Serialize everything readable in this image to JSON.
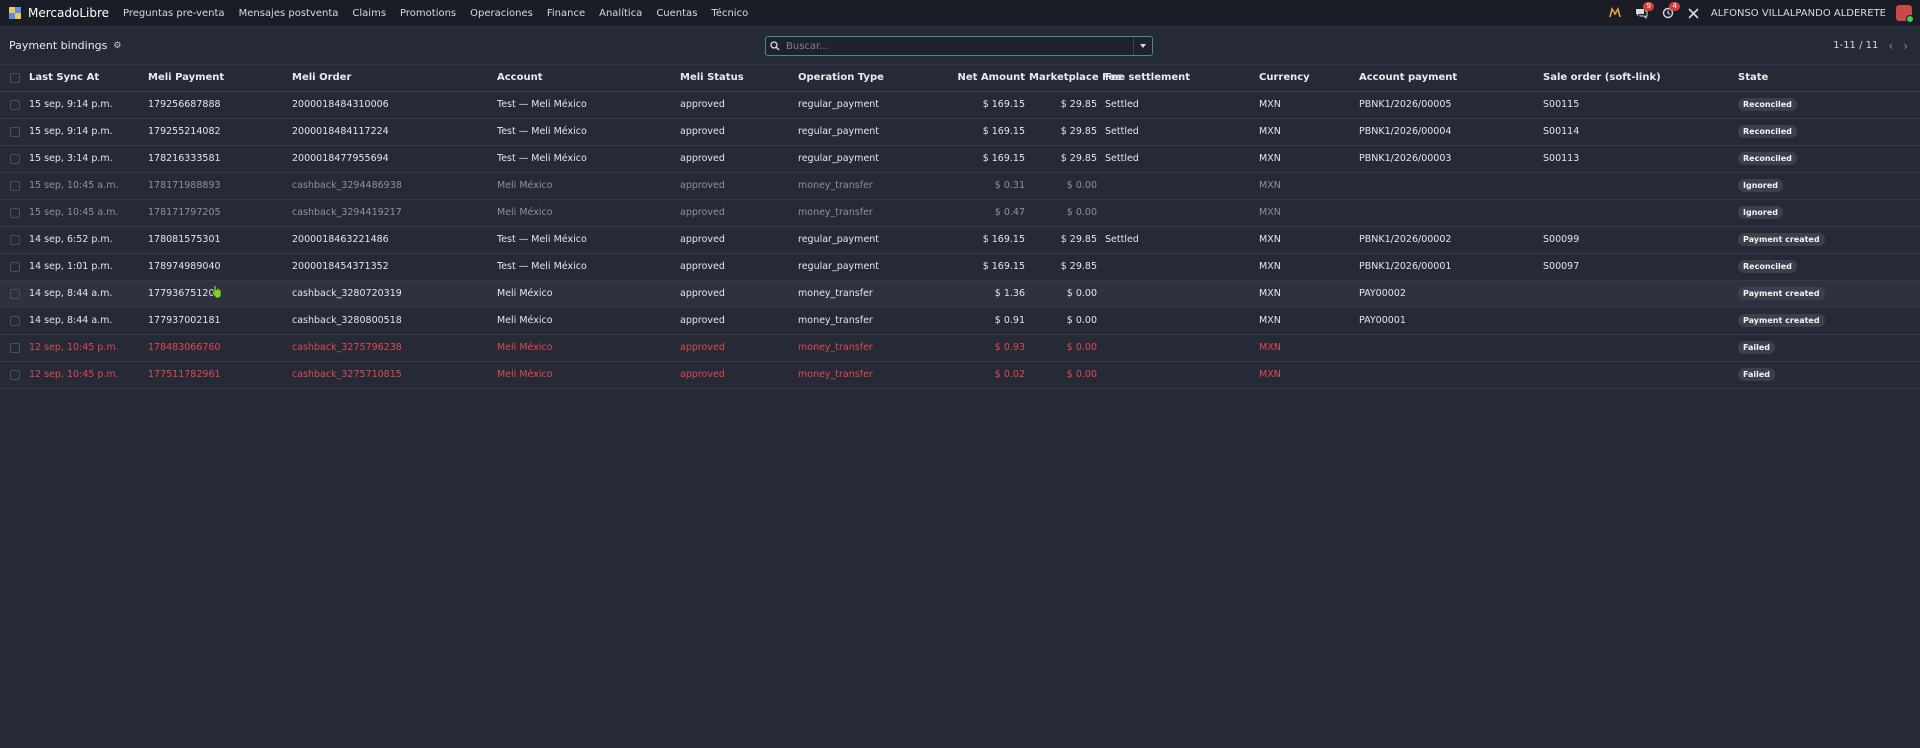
{
  "nav": {
    "brand": "MercadoLibre",
    "menu": [
      "Preguntas pre-venta",
      "Mensajes postventa",
      "Claims",
      "Promotions",
      "Operaciones",
      "Finance",
      "Analítica",
      "Cuentas",
      "Técnico"
    ],
    "messages_badge": "9",
    "activities_badge": "4",
    "user": "ALFONSO VILLALPANDO ALDERETE"
  },
  "control": {
    "title": "Payment bindings",
    "search_placeholder": "Buscar...",
    "pager": "1-11 / 11"
  },
  "table": {
    "headers": [
      "Last Sync At",
      "Meli Payment",
      "Meli Order",
      "Account",
      "Meli Status",
      "Operation Type",
      "Net Amount",
      "Marketplace Fee",
      "Fee settlement",
      "Currency",
      "Account payment",
      "Sale order (soft-link)",
      "State"
    ],
    "rows": [
      {
        "style": "normal",
        "cells": [
          "15 sep, 9:14 p.m.",
          "179256687888",
          "2000018484310006",
          "Test — Meli México",
          "approved",
          "regular_payment",
          "$ 169.15",
          "$ 29.85",
          "Settled",
          "MXN",
          "PBNK1/2026/00005",
          "S00115",
          "Reconciled"
        ]
      },
      {
        "style": "normal",
        "cells": [
          "15 sep, 9:14 p.m.",
          "179255214082",
          "2000018484117224",
          "Test — Meli México",
          "approved",
          "regular_payment",
          "$ 169.15",
          "$ 29.85",
          "Settled",
          "MXN",
          "PBNK1/2026/00004",
          "S00114",
          "Reconciled"
        ]
      },
      {
        "style": "normal",
        "cells": [
          "15 sep, 3:14 p.m.",
          "178216333581",
          "2000018477955694",
          "Test — Meli México",
          "approved",
          "regular_payment",
          "$ 169.15",
          "$ 29.85",
          "Settled",
          "MXN",
          "PBNK1/2026/00003",
          "S00113",
          "Reconciled"
        ]
      },
      {
        "style": "muted",
        "cells": [
          "15 sep, 10:45 a.m.",
          "178171988893",
          "cashback_3294486938",
          "Meli México",
          "approved",
          "money_transfer",
          "$ 0.31",
          "$ 0.00",
          "",
          "MXN",
          "",
          "",
          "Ignored"
        ]
      },
      {
        "style": "muted",
        "cells": [
          "15 sep, 10:45 a.m.",
          "178171797205",
          "cashback_3294419217",
          "Meli México",
          "approved",
          "money_transfer",
          "$ 0.47",
          "$ 0.00",
          "",
          "MXN",
          "",
          "",
          "Ignored"
        ]
      },
      {
        "style": "normal",
        "cells": [
          "14 sep, 6:52 p.m.",
          "178081575301",
          "2000018463221486",
          "Test — Meli México",
          "approved",
          "regular_payment",
          "$ 169.15",
          "$ 29.85",
          "Settled",
          "MXN",
          "PBNK1/2026/00002",
          "S00099",
          "Payment created"
        ]
      },
      {
        "style": "normal",
        "cells": [
          "14 sep, 1:01 p.m.",
          "178974989040",
          "2000018454371352",
          "Test — Meli México",
          "approved",
          "regular_payment",
          "$ 169.15",
          "$ 29.85",
          "",
          "MXN",
          "PBNK1/2026/00001",
          "S00097",
          "Reconciled"
        ]
      },
      {
        "style": "hover",
        "cells": [
          "14 sep, 8:44 a.m.",
          "177936751207",
          "cashback_3280720319",
          "Meli México",
          "approved",
          "money_transfer",
          "$ 1.36",
          "$ 0.00",
          "",
          "MXN",
          "PAY00002",
          "",
          "Payment created"
        ]
      },
      {
        "style": "normal",
        "cells": [
          "14 sep, 8:44 a.m.",
          "177937002181",
          "cashback_3280800518",
          "Meli México",
          "approved",
          "money_transfer",
          "$ 0.91",
          "$ 0.00",
          "",
          "MXN",
          "PAY00001",
          "",
          "Payment created"
        ]
      },
      {
        "style": "failed",
        "cells": [
          "12 sep, 10:45 p.m.",
          "178483066760",
          "cashback_3275796238",
          "Meli México",
          "approved",
          "money_transfer",
          "$ 0.93",
          "$ 0.00",
          "",
          "MXN",
          "",
          "",
          "Failed"
        ]
      },
      {
        "style": "failed",
        "cells": [
          "12 sep, 10:45 p.m.",
          "177511782961",
          "cashback_3275710815",
          "Meli México",
          "approved",
          "money_transfer",
          "$ 0.02",
          "$ 0.00",
          "",
          "MXN",
          "",
          "",
          "Failed"
        ]
      }
    ]
  },
  "colors": {
    "background": "#262a36",
    "navbar": "#1b1d26",
    "failed": "#e0494f",
    "accent": "#3d8f91"
  }
}
